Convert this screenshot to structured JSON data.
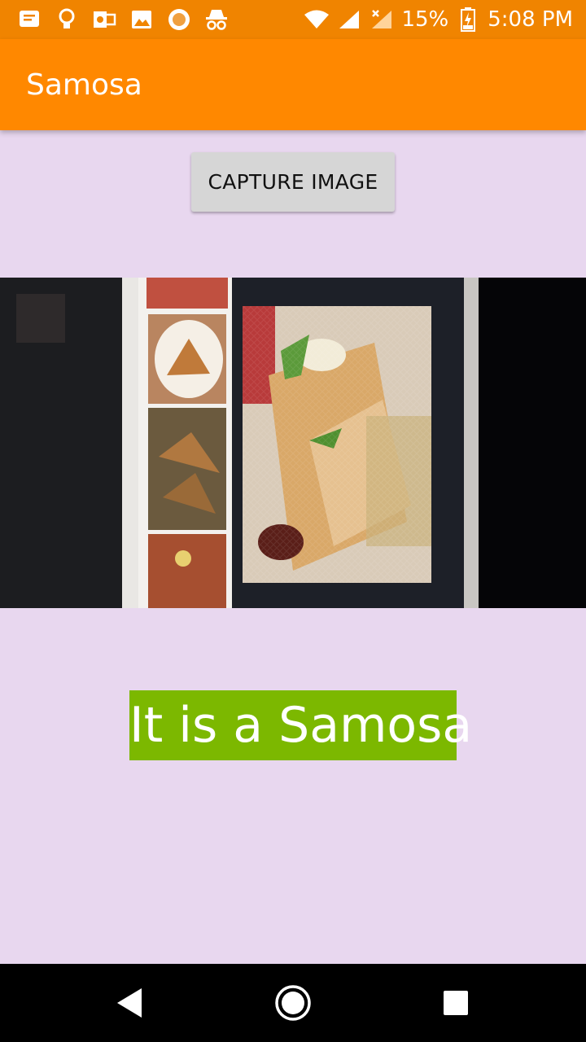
{
  "status_bar": {
    "battery_percent": "15%",
    "time": "5:08 PM",
    "left_icons": [
      "message-icon",
      "lightbulb-icon",
      "outlook-icon",
      "gallery-icon",
      "record-icon",
      "incognito-icon"
    ],
    "right_icons": [
      "wifi-icon",
      "signal-icon",
      "signal-no-service-icon",
      "battery-charging-icon"
    ]
  },
  "app_bar": {
    "title": "Samosa"
  },
  "main": {
    "capture_button_label": "CAPTURE IMAGE",
    "result_text": "It is a Samosa"
  },
  "nav_bar": {
    "icons": [
      "back-icon",
      "home-icon",
      "recents-icon"
    ]
  },
  "colors": {
    "status_bar": "#f08400",
    "app_bar": "#ff8800",
    "background": "#e8d7ef",
    "result_highlight": "#7cb800",
    "button": "#d6d6d6"
  }
}
